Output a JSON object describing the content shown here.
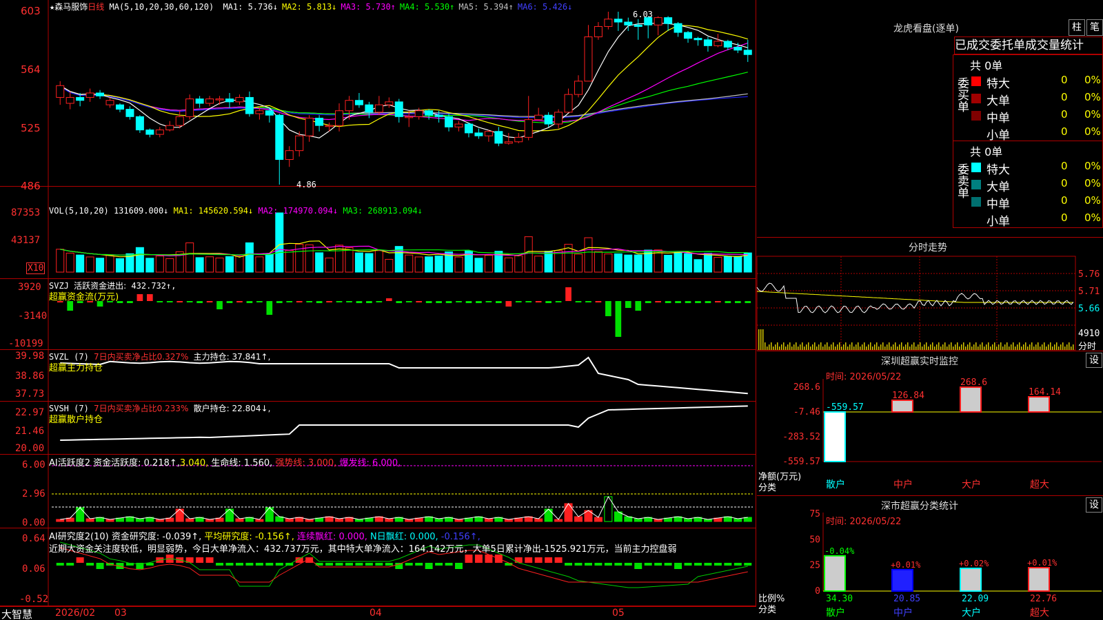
{
  "stock": {
    "star": "★",
    "name": "森马服饰",
    "period": "日线",
    "params": "MA(5,10,20,30,60,120)"
  },
  "ma_header": [
    {
      "label": "MA1:",
      "value": "5.736↓",
      "color": "#ffffff"
    },
    {
      "label": "MA2:",
      "value": "5.813↓",
      "color": "#ffff00"
    },
    {
      "label": "MA3:",
      "value": "5.730↑",
      "color": "#ff00ff"
    },
    {
      "label": "MA4:",
      "value": "5.530↑",
      "color": "#00ff00"
    },
    {
      "label": "MA5:",
      "value": "5.394↑",
      "color": "#c0c0c0"
    },
    {
      "label": "MA6:",
      "value": "5.426↓",
      "color": "#4040ff"
    }
  ],
  "price_axis": [
    "603",
    "564",
    "525",
    "486"
  ],
  "price_marks": {
    "high": "6.03",
    "low": "4.86"
  },
  "vol": {
    "header": "VOL(5,10,20)",
    "value": "131609.000↓",
    "ma1": "MA1: 145620.594↓",
    "ma2": "MA2: 174970.094↓",
    "ma3": "MA3: 268913.094↓",
    "axis": [
      "87353",
      "43137"
    ],
    "unit": "X10"
  },
  "svzj": {
    "name": "SVZJ",
    "label": "活跃资金进出:",
    "value": "432.732↑,",
    "sub": "超赢资金流(万元)",
    "axis": [
      "3920",
      "-3140",
      "-10199"
    ]
  },
  "svzl": {
    "name": "SVZL (7)",
    "label": "7日内买卖净占比0.327%",
    "hold": "主力持仓: 37.841↑,",
    "sub": "超赢主力持仓",
    "axis": [
      "39.98",
      "38.86",
      "37.73"
    ]
  },
  "svsh": {
    "name": "SVSH (7)",
    "label": "7日内买卖净占比0.233%",
    "hold": "散户持仓: 22.804↓,",
    "sub": "超赢散户持仓",
    "axis": [
      "22.97",
      "21.46",
      "20.00"
    ]
  },
  "ai1": {
    "name": "AI活跃度2",
    "t1": "资金活跃度: 0.218↑,",
    "t2": "3.040,",
    "t3": "生命线: 1.560,",
    "t4": "强势线: 3.000,",
    "t5": "爆发线: 6.000,",
    "axis": [
      "6.00",
      "2.96",
      "0.00"
    ]
  },
  "ai2": {
    "name": "AI研究度2(10)",
    "t1": "资金研究度: -0.039↑,",
    "t2": "平均研究度: -0.156↑,",
    "t3": "连续飘红: 0.000,",
    "t4": "N日飘红: 0.000,",
    "t5": "-0.156↑,",
    "desc": "近期大资金关注度较低，明显弱势，今日大单净流入：432.737万元，其中特大单净流入：164.142万元，大单5日累计净出-1525.921万元，当前主力控盘弱",
    "axis": [
      "0.64",
      "0.06",
      "-0.52"
    ]
  },
  "date_axis": {
    "brand": "大智慧",
    "labels": [
      "2026/02",
      "03",
      "04",
      "05"
    ]
  },
  "dragon": {
    "title": "龙虎看盘(逐单)",
    "btn1": "柱",
    "btn2": "笔",
    "tabs": "已成交委托单成交量统计",
    "buy": {
      "side": "委买单",
      "total": "共 0单",
      "rows": [
        {
          "label": "特大",
          "v": "0",
          "p": "0%",
          "c": "#ff0000"
        },
        {
          "label": "大单",
          "v": "0",
          "p": "0%",
          "c": "#a00000"
        },
        {
          "label": "中单",
          "v": "0",
          "p": "0%",
          "c": "#800000"
        },
        {
          "label": "小单",
          "v": "0",
          "p": "0%",
          "c": "#000000"
        }
      ]
    },
    "sell": {
      "side": "委卖单",
      "total": "共 0单",
      "rows": [
        {
          "label": "特大",
          "v": "0",
          "p": "0%",
          "c": "#00ffff"
        },
        {
          "label": "大单",
          "v": "0",
          "p": "0%",
          "c": "#008080"
        },
        {
          "label": "中单",
          "v": "0",
          "p": "0%",
          "c": "#007070"
        },
        {
          "label": "小单",
          "v": "0",
          "p": "0%",
          "c": "#000000"
        }
      ]
    }
  },
  "intraday": {
    "title": "分时走势",
    "axis": [
      "5.76",
      "5.71",
      "5.66"
    ],
    "vol": "4910",
    "vol_label": "分时"
  },
  "monitor": {
    "title": "深圳超赢实时监控",
    "btn": "设",
    "time": "时间: 2026/05/22",
    "axis": [
      "268.6",
      "-7.46",
      "-283.52",
      "-559.57"
    ],
    "ylabel1": "净额(万元)",
    "ylabel2": "分类",
    "chart_data": {
      "type": "bar",
      "categories": [
        "散户",
        "中户",
        "大户",
        "超大"
      ],
      "values": [
        -559.57,
        126.84,
        268.6,
        164.14
      ],
      "labels": [
        "-559.57",
        "126.84",
        "268.6",
        "164.14"
      ]
    }
  },
  "classify": {
    "title": "深市超赢分类统计",
    "btn": "设",
    "time": "时间: 2026/05/22",
    "axis": [
      "75",
      "50",
      "25",
      "0"
    ],
    "ylabel1": "比例%",
    "ylabel2": "分类",
    "chart_data": {
      "type": "bar",
      "categories": [
        "散户",
        "中户",
        "大户",
        "超大"
      ],
      "values": [
        34.3,
        20.85,
        22.09,
        22.76
      ],
      "changes": [
        "-0.04%",
        "+0.01%",
        "+0.02%",
        "+0.01%"
      ],
      "labels": [
        "34.30",
        "20.85",
        "22.09",
        "22.76"
      ]
    }
  },
  "chart_data": {
    "type": "candlestick",
    "candles": [
      [
        5.45,
        5.53,
        5.4,
        5.56
      ],
      [
        5.41,
        5.45,
        5.37,
        5.49
      ],
      [
        5.45,
        5.43,
        5.39,
        5.48
      ],
      [
        5.45,
        5.48,
        5.42,
        5.51
      ],
      [
        5.48,
        5.46,
        5.44,
        5.5
      ],
      [
        5.4,
        5.43,
        5.38,
        5.45
      ],
      [
        5.4,
        5.37,
        5.35,
        5.41
      ],
      [
        5.37,
        5.32,
        5.3,
        5.39
      ],
      [
        5.32,
        5.23,
        5.21,
        5.33
      ],
      [
        5.23,
        5.2,
        5.18,
        5.24
      ],
      [
        5.2,
        5.23,
        5.18,
        5.25
      ],
      [
        5.23,
        5.26,
        5.22,
        5.29
      ],
      [
        5.26,
        5.32,
        5.24,
        5.36
      ],
      [
        5.32,
        5.44,
        5.3,
        5.47
      ],
      [
        5.44,
        5.41,
        5.38,
        5.46
      ],
      [
        5.41,
        5.44,
        5.39,
        5.46
      ],
      [
        5.44,
        5.44,
        5.4,
        5.46
      ],
      [
        5.44,
        5.42,
        5.38,
        5.48
      ],
      [
        5.42,
        5.45,
        5.4,
        5.47
      ],
      [
        5.45,
        5.34,
        5.32,
        5.49
      ],
      [
        5.34,
        5.36,
        5.3,
        5.39
      ],
      [
        5.36,
        5.33,
        5.28,
        5.38
      ],
      [
        5.33,
        5.03,
        4.86,
        5.34
      ],
      [
        5.03,
        5.09,
        4.98,
        5.12
      ],
      [
        5.09,
        5.19,
        5.05,
        5.22
      ],
      [
        5.19,
        5.31,
        5.15,
        5.33
      ],
      [
        5.31,
        5.26,
        5.22,
        5.33
      ],
      [
        5.26,
        5.26,
        5.22,
        5.28
      ],
      [
        5.26,
        5.36,
        5.22,
        5.41
      ],
      [
        5.36,
        5.43,
        5.3,
        5.46
      ],
      [
        5.43,
        5.4,
        5.38,
        5.48
      ],
      [
        5.4,
        5.35,
        5.31,
        5.42
      ],
      [
        5.35,
        5.4,
        5.33,
        5.46
      ],
      [
        5.4,
        5.42,
        5.38,
        5.45
      ],
      [
        5.42,
        5.32,
        5.28,
        5.44
      ],
      [
        5.32,
        5.32,
        5.25,
        5.36
      ],
      [
        5.32,
        5.36,
        5.3,
        5.38
      ],
      [
        5.36,
        5.33,
        5.3,
        5.37
      ],
      [
        5.33,
        5.32,
        5.28,
        5.36
      ],
      [
        5.32,
        5.25,
        5.22,
        5.34
      ],
      [
        5.25,
        5.27,
        5.22,
        5.29
      ],
      [
        5.27,
        5.21,
        5.18,
        5.28
      ],
      [
        5.21,
        5.19,
        5.17,
        5.24
      ],
      [
        5.19,
        5.22,
        5.15,
        5.23
      ],
      [
        5.22,
        5.14,
        5.12,
        5.25
      ],
      [
        5.14,
        5.15,
        5.13,
        5.21
      ],
      [
        5.15,
        5.18,
        5.14,
        5.21
      ],
      [
        5.18,
        5.3,
        5.16,
        5.46
      ],
      [
        5.3,
        5.33,
        5.3,
        5.38
      ],
      [
        5.33,
        5.27,
        5.25,
        5.35
      ],
      [
        5.27,
        5.35,
        5.24,
        5.37
      ],
      [
        5.35,
        5.47,
        5.35,
        5.51
      ],
      [
        5.47,
        5.56,
        5.45,
        5.6
      ],
      [
        5.56,
        5.86,
        5.56,
        5.94
      ],
      [
        5.86,
        5.93,
        5.84,
        5.96
      ],
      [
        5.93,
        5.98,
        5.91,
        6.03
      ],
      [
        5.98,
        5.96,
        5.9,
        6.03
      ],
      [
        5.96,
        5.94,
        5.9,
        5.99
      ],
      [
        5.94,
        5.93,
        5.84,
        5.98
      ],
      [
        5.99,
        5.94,
        5.85,
        6.0
      ],
      [
        5.94,
        5.99,
        5.87,
        6.0
      ],
      [
        5.99,
        5.95,
        5.9,
        6.0
      ],
      [
        5.95,
        5.89,
        5.86,
        5.96
      ],
      [
        5.89,
        5.85,
        5.82,
        5.9
      ],
      [
        5.85,
        5.84,
        5.8,
        5.86
      ],
      [
        5.84,
        5.8,
        5.76,
        5.86
      ],
      [
        5.8,
        5.83,
        5.79,
        5.88
      ],
      [
        5.83,
        5.79,
        5.77,
        5.84
      ],
      [
        5.79,
        5.77,
        5.75,
        5.82
      ],
      [
        5.77,
        5.74,
        5.69,
        5.84
      ]
    ]
  }
}
